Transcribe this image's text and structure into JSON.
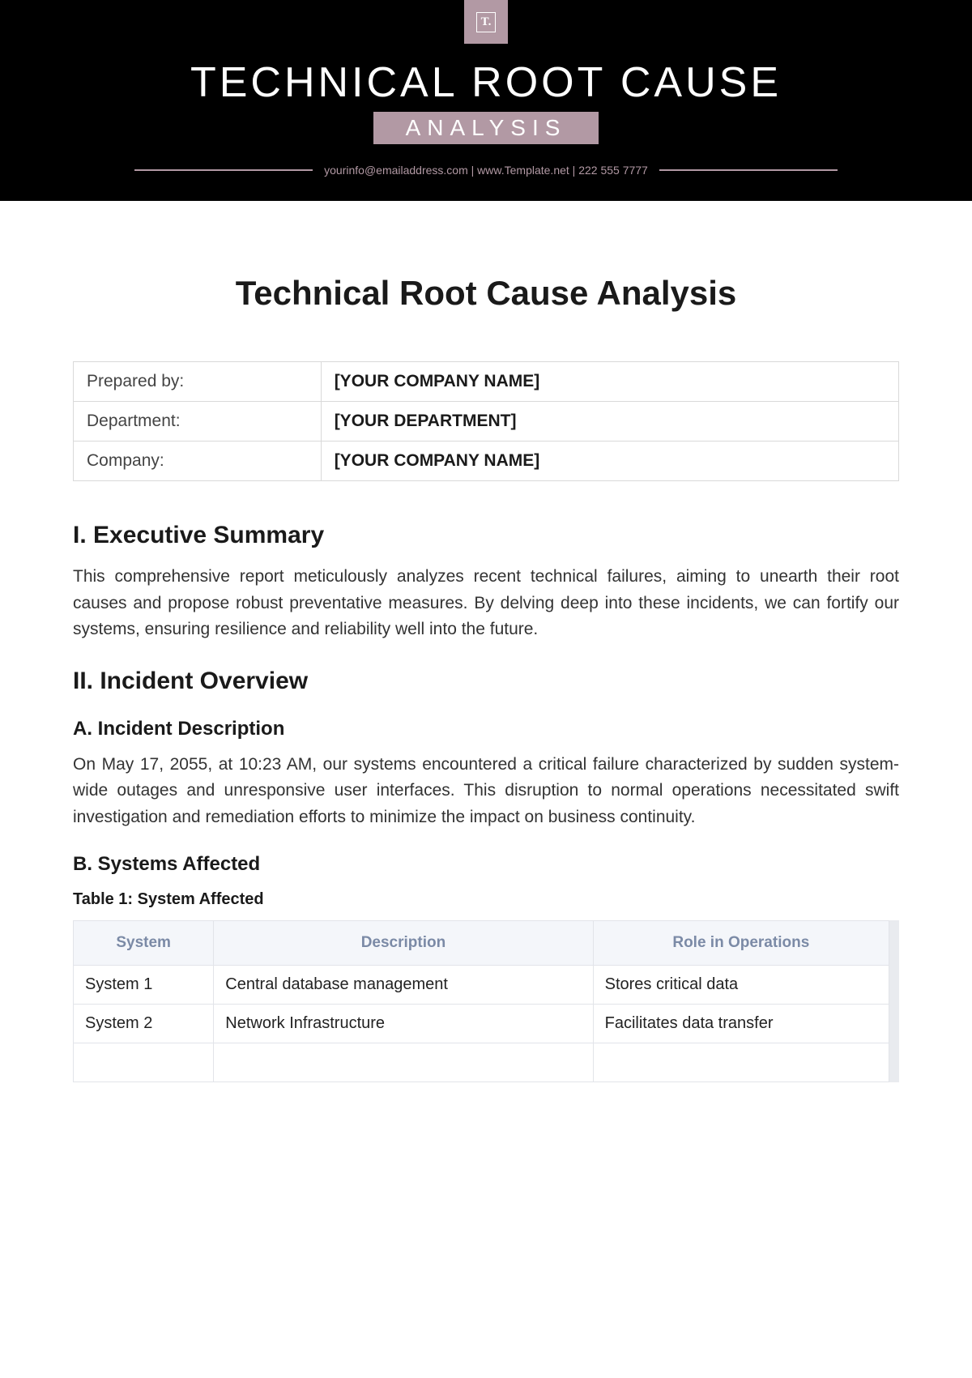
{
  "header": {
    "logo_text": "T.",
    "title_line1": "TECHNICAL ROOT CAUSE",
    "title_line2": "ANALYSIS",
    "contact": "yourinfo@emailaddress.com  |  www.Template.net  |  222 555 7777"
  },
  "document": {
    "title": "Technical Root Cause Analysis",
    "meta": [
      {
        "label": "Prepared by:",
        "value": "[YOUR COMPANY NAME]"
      },
      {
        "label": "Department:",
        "value": "[YOUR DEPARTMENT]"
      },
      {
        "label": "Company:",
        "value": "[YOUR COMPANY NAME]"
      }
    ],
    "sections": {
      "exec_summary": {
        "heading": "I. Executive Summary",
        "body": "This comprehensive report meticulously analyzes recent technical failures, aiming to unearth their root causes and propose robust preventative measures. By delving deep into these incidents, we can fortify our systems, ensuring resilience and reliability well into the future."
      },
      "incident_overview": {
        "heading": "II. Incident Overview",
        "sub_a": {
          "heading": "A. Incident Description",
          "body": "On May 17, 2055, at 10:23 AM, our systems encountered a critical failure characterized by sudden system-wide outages and unresponsive user interfaces. This disruption to normal operations necessitated swift investigation and remediation efforts to minimize the impact on business continuity."
        },
        "sub_b": {
          "heading": "B. Systems Affected",
          "table_caption": "Table 1: System Affected",
          "table": {
            "headers": [
              "System",
              "Description",
              "Role in Operations"
            ],
            "rows": [
              [
                "System 1",
                "Central database management",
                "Stores critical data"
              ],
              [
                "System 2",
                "Network Infrastructure",
                "Facilitates data transfer"
              ]
            ]
          }
        }
      }
    }
  }
}
